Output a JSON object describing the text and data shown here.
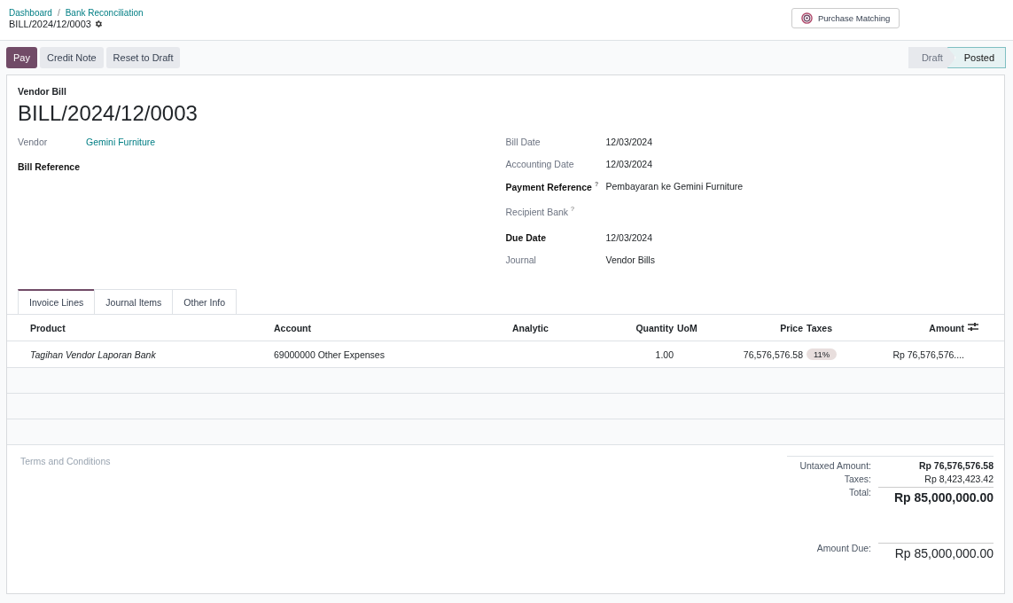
{
  "breadcrumbs": [
    "Dashboard",
    "Bank Reconciliation"
  ],
  "breadcrumb_separator": "/",
  "record_name": "BILL/2024/12/0003",
  "smart_button": {
    "label": "Purchase Matching"
  },
  "actions": [
    {
      "label": "Pay",
      "primary": true
    },
    {
      "label": "Credit Note",
      "primary": false
    },
    {
      "label": "Reset to Draft",
      "primary": false
    }
  ],
  "status_steps": [
    {
      "label": "Draft",
      "selected": false
    },
    {
      "label": "Posted",
      "selected": true
    }
  ],
  "form": {
    "type_label": "Vendor Bill",
    "title": "BILL/2024/12/0003",
    "left_fields": [
      {
        "label": "Vendor",
        "value": "Gemini Furniture",
        "emphasized": false
      },
      {
        "label": "Bill Reference",
        "emphasized": true
      }
    ],
    "right_fields": [
      {
        "label": "Bill Date",
        "value": "12/03/2024",
        "emphasized": false
      },
      {
        "label": "Accounting Date",
        "value": "12/03/2024",
        "emphasized": false
      },
      {
        "label": "Payment Reference $^{?}$",
        "value": "Pembayaran ke Gemini Furniture",
        "emphasized": true
      },
      {
        "label": "Recipient Bank $^{?}$",
        "emphasized": false
      },
      {
        "label": "Due Date",
        "value": "12/03/2024",
        "emphasized": true
      },
      {
        "label": "Journal",
        "value": "Vendor Bills",
        "emphasized": false
      }
    ]
  },
  "tabs": [
    {
      "label": "Invoice Lines",
      "selected": true
    },
    {
      "label": "Journal Items",
      "selected": false
    },
    {
      "label": "Other Info",
      "selected": false
    }
  ],
  "table": {
    "columns": [
      "Product",
      "Account",
      "Analytic",
      "Quantity",
      "UoM",
      "Price",
      "Taxes",
      "Amount"
    ],
    "rows": [
      {
        "product": "Tagihan Vendor Laporan Bank",
        "account": "69000000 Other Expenses",
        "quantity": "1.00",
        "price": "76,576,576.58",
        "taxes": "11%",
        "amount": "Rp 76,576,576...."
      }
    ]
  },
  "terms_placeholder": "Terms and Conditions",
  "totals": [
    {
      "label": "Untaxed Amount:",
      "value": "Rp 76,576,576.58",
      "kind": "subtotal"
    },
    {
      "label": "Taxes:",
      "value": "Rp 8,423,423.42",
      "kind": "tax"
    },
    {
      "label": "Total:",
      "value": "Rp 85,000,000.00",
      "kind": "total"
    },
    {
      "label": "Amount Due:",
      "value": "Rp 85,000,000.00",
      "kind": "due"
    }
  ]
}
